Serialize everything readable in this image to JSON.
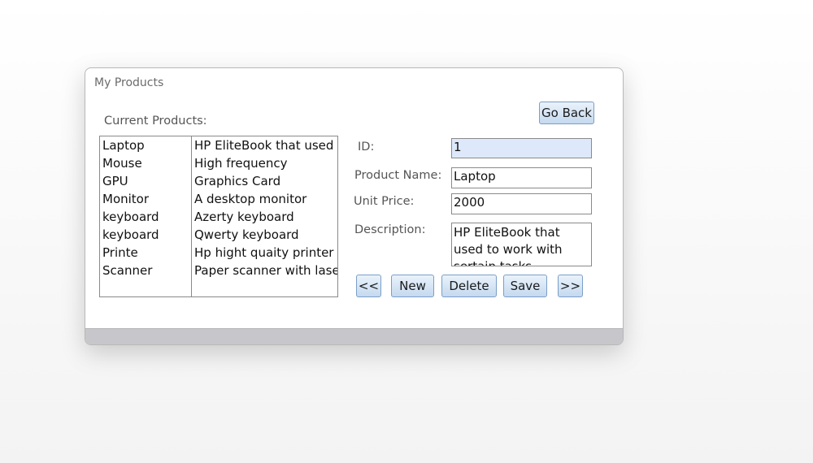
{
  "window": {
    "title": "My Products"
  },
  "list": {
    "heading": "Current Products:",
    "rows": [
      {
        "name": "Laptop",
        "description": "HP EliteBook that used to"
      },
      {
        "name": "Mouse",
        "description": "High frequency"
      },
      {
        "name": "GPU",
        "description": "Graphics Card"
      },
      {
        "name": "Monitor",
        "description": "A desktop monitor"
      },
      {
        "name": "keyboard",
        "description": "Azerty keyboard"
      },
      {
        "name": "keyboard",
        "description": "Qwerty keyboard"
      },
      {
        "name": "Printe",
        "description": "Hp hight quaity printer"
      },
      {
        "name": "Scanner",
        "description": "Paper scanner with laser t"
      }
    ]
  },
  "form": {
    "id_label": "ID:",
    "id_value": "1",
    "name_label": "Product Name:",
    "name_value": "Laptop",
    "price_label": "Unit Price:",
    "price_value": "2000",
    "description_label": "Description:",
    "description_value": "HP EliteBook that used to work with sertain tasks"
  },
  "buttons": {
    "go_back": "Go Back",
    "prev": "<<",
    "new": "New",
    "delete": "Delete",
    "save": "Save",
    "next": ">>"
  }
}
